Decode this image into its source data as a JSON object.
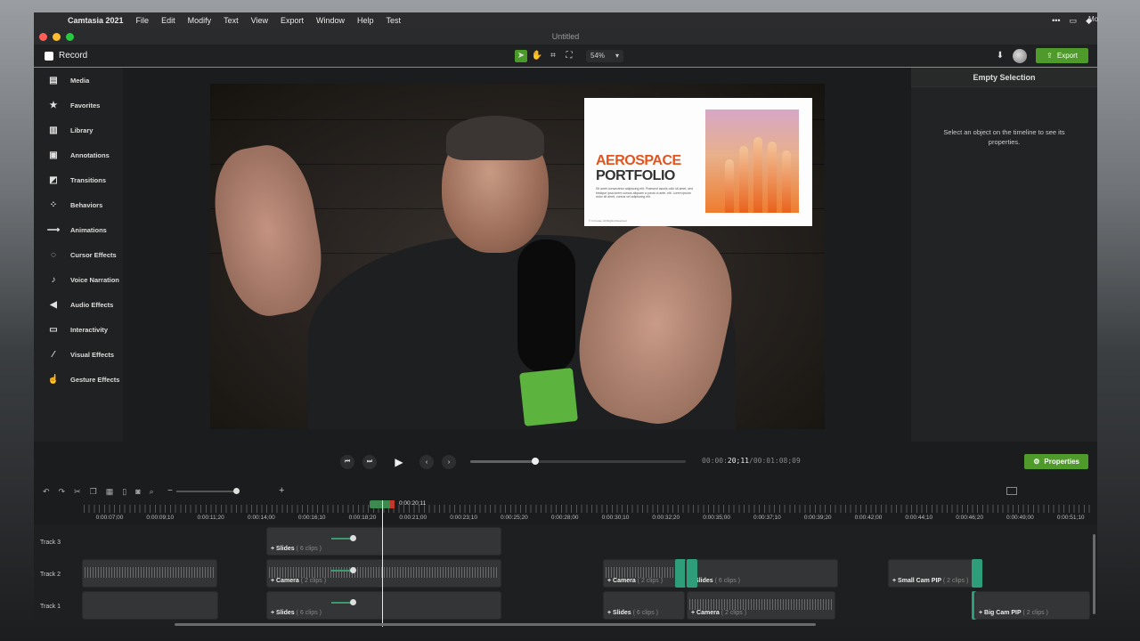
{
  "menubar": {
    "app": "Camtasia 2021",
    "items": [
      "File",
      "Edit",
      "Modify",
      "Text",
      "View",
      "Export",
      "Window",
      "Help",
      "Test"
    ],
    "right_text": "Mo"
  },
  "window": {
    "title": "Untitled"
  },
  "toolbar": {
    "record_label": "Record",
    "zoom_value": "54%",
    "export_label": "Export"
  },
  "sidebar": {
    "items": [
      {
        "label": "Media",
        "icon": "film-strip-icon"
      },
      {
        "label": "Favorites",
        "icon": "star-icon"
      },
      {
        "label": "Library",
        "icon": "library-icon"
      },
      {
        "label": "Annotations",
        "icon": "annotation-icon"
      },
      {
        "label": "Transitions",
        "icon": "transition-icon"
      },
      {
        "label": "Behaviors",
        "icon": "behavior-icon"
      },
      {
        "label": "Animations",
        "icon": "animation-icon"
      },
      {
        "label": "Cursor Effects",
        "icon": "cursor-icon"
      },
      {
        "label": "Voice Narration",
        "icon": "microphone-icon"
      },
      {
        "label": "Audio Effects",
        "icon": "speaker-icon"
      },
      {
        "label": "Interactivity",
        "icon": "interactivity-icon"
      },
      {
        "label": "Visual Effects",
        "icon": "wand-icon"
      },
      {
        "label": "Gesture Effects",
        "icon": "hand-icon"
      }
    ]
  },
  "slide": {
    "title_line1": "AEROSPACE",
    "title_line2": "PORTFOLIO",
    "body": "Sit amet consectetur adipiscing elit. Praesent iaculis odio sit amet, sed tristique ipsa lorem cursus aliquam a purus ut ante, elit. Lorem ipsum dolor sit amet, cursus vel adipiscing elit.",
    "footer": "© In house. All Rights Reserved"
  },
  "properties": {
    "header": "Empty Selection",
    "message": "Select an object on the timeline to see its properties.",
    "button_label": "Properties"
  },
  "player": {
    "time_current_dim": "00:00:",
    "time_current_bright": "20;11",
    "time_total": "/00:01:08;09",
    "progress_fraction": 0.3
  },
  "timeline": {
    "playhead_time": "0:00:20;11",
    "ticks": [
      "0:00:07;00",
      "0:00:09;10",
      "0:00:11;20",
      "0:00:14;00",
      "0:00:16;10",
      "0:00:18;20",
      "0:00:21;00",
      "0:00:23;10",
      "0:00:25;20",
      "0:00:28;00",
      "0:00:30;10",
      "0:00:32;20",
      "0:00:35;00",
      "0:00:37;10",
      "0:00:39;20",
      "0:00:42;00",
      "0:00:44;10",
      "0:00:46;20",
      "0:00:49;00",
      "0:00:51;10"
    ],
    "tracks": [
      "Track 3",
      "Track 2",
      "Track 1"
    ],
    "clips": {
      "t3_slides": {
        "name": "Slides",
        "count": "( 6 clips )"
      },
      "t2_camera_a": {
        "name": "Camera",
        "count": "( 2 clips )"
      },
      "t2_camera_b": {
        "name": "Camera",
        "count": "( 2 clips )"
      },
      "t2_slides": {
        "name": "Slides",
        "count": "( 6 clips )"
      },
      "t2_smallcam": {
        "name": "Small Cam PIP",
        "count": "( 2 clips )"
      },
      "t1_slides_a": {
        "name": "Slides",
        "count": "( 6 clips )"
      },
      "t1_slides_b": {
        "name": "Slides",
        "count": "( 6 clips )"
      },
      "t1_camera": {
        "name": "Camera",
        "count": "( 2 clips )"
      },
      "t1_bigcam": {
        "name": "Big Cam PIP",
        "count": "( 2 clips )"
      }
    }
  },
  "colors": {
    "accent_green": "#4e9a2a",
    "transition_teal": "#2d9d7a",
    "slide_orange": "#e4531c"
  }
}
